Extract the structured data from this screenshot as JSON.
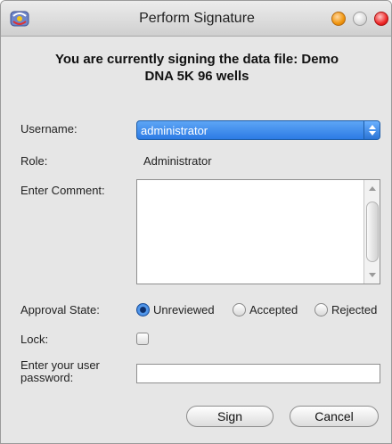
{
  "window": {
    "title": "Perform Signature"
  },
  "heading": {
    "line1": "You are currently signing the data file: Demo",
    "line2": "DNA 5K 96 wells"
  },
  "form": {
    "username_label": "Username:",
    "username_value": "administrator",
    "role_label": "Role:",
    "role_value": "Administrator",
    "comment_label": "Enter Comment:",
    "comment_value": "",
    "approval_label": "Approval State:",
    "approval_options": [
      {
        "label": "Unreviewed",
        "selected": true
      },
      {
        "label": "Accepted",
        "selected": false
      },
      {
        "label": "Rejected",
        "selected": false
      }
    ],
    "lock_label": "Lock:",
    "lock_checked": false,
    "password_label_line1": "Enter your user",
    "password_label_line2": "password:",
    "password_value": ""
  },
  "buttons": {
    "sign": "Sign",
    "cancel": "Cancel"
  },
  "colors": {
    "selection_blue": "#2c7be5",
    "window_bg": "#e6e6e6"
  },
  "icons": {
    "app": "dna-app-icon",
    "select": "up-down-arrows-icon"
  }
}
